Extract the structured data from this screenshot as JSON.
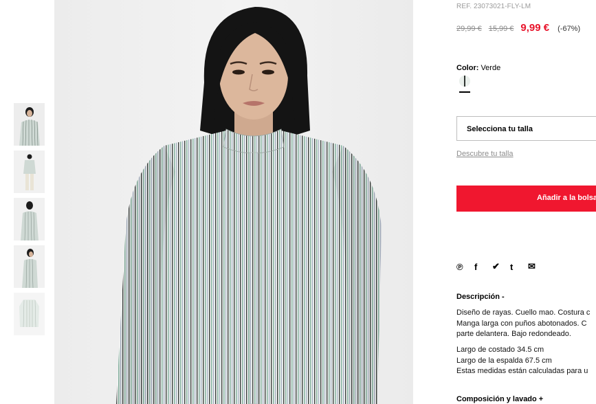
{
  "gallery": {
    "thumbnails": [
      {
        "label": "shirt front model"
      },
      {
        "label": "full body model"
      },
      {
        "label": "back view model"
      },
      {
        "label": "side view model"
      },
      {
        "label": "shirt flat lay"
      }
    ]
  },
  "product": {
    "reference": "REF. 23073021-FLY-LM",
    "price_original": "29,99 €",
    "price_previous": "15,99 €",
    "price_current": "9,99 €",
    "discount": "(-67%)",
    "color_label": "Color:",
    "color_value": "Verde",
    "size_select": "Selecciona tu talla",
    "size_guide_link": "Descubre tu talla",
    "add_to_bag": "Añadir a la bolsa"
  },
  "share": {
    "icons": [
      "pinterest-icon",
      "facebook-icon",
      "twitter-icon",
      "tumblr-icon",
      "email-icon"
    ],
    "glyphs": [
      "℗",
      "f",
      "✔",
      "t",
      "✉"
    ]
  },
  "description": {
    "title": "Descripción  -",
    "lines": [
      "Diseño de rayas. Cuello mao. Costura c",
      "Manga larga con puños abotonados. C",
      "parte delantera. Bajo redondeado."
    ],
    "measures": [
      "Largo de costado 34.5 cm",
      "Largo de la espalda 67.5 cm",
      "Estas medidas están calculadas para u"
    ]
  },
  "composition": {
    "title": "Composición y lavado  +"
  },
  "colors": {
    "accent": "#f0172f",
    "price_red": "#e8132a"
  }
}
